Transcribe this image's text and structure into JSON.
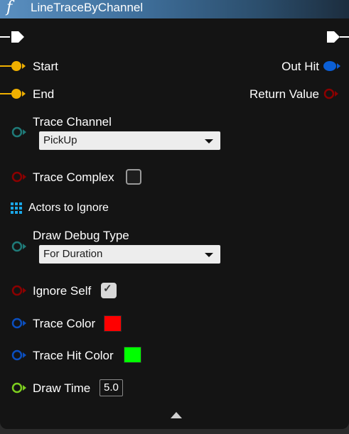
{
  "node": {
    "title": "LineTraceByChannel",
    "icon": "function-icon"
  },
  "pins": {
    "start": {
      "label": "Start",
      "color": "#f0b000"
    },
    "end": {
      "label": "End",
      "color": "#f0b000"
    },
    "out_hit": {
      "label": "Out Hit",
      "color": "#0b5fd6"
    },
    "return_value": {
      "label": "Return Value",
      "color": "#8b0000"
    },
    "trace_channel": {
      "label": "Trace Channel",
      "value": "PickUp",
      "color": "#1f7a78"
    },
    "trace_complex": {
      "label": "Trace Complex",
      "checked": false,
      "color": "#8b0000"
    },
    "actors_to_ignore": {
      "label": "Actors to Ignore",
      "color": "#1aa7e8"
    },
    "draw_debug_type": {
      "label": "Draw Debug Type",
      "value": "For Duration",
      "color": "#1f7a78"
    },
    "ignore_self": {
      "label": "Ignore Self",
      "checked": true,
      "color": "#8b0000"
    },
    "trace_color": {
      "label": "Trace Color",
      "swatch": "#ff0000",
      "color": "#0b4fbf"
    },
    "trace_hit_color": {
      "label": "Trace Hit Color",
      "swatch": "#00ff00",
      "color": "#0b4fbf"
    },
    "draw_time": {
      "label": "Draw Time",
      "value": "5.0",
      "color": "#7dcf1f"
    }
  }
}
